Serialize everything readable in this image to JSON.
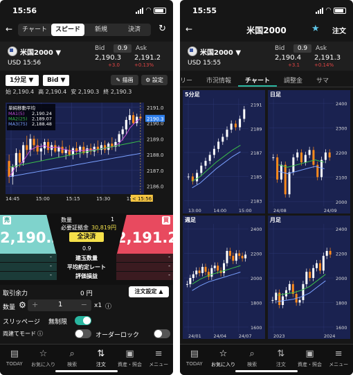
{
  "left": {
    "status": {
      "time": "15:56"
    },
    "tabs": [
      "チャート",
      "スピード",
      "新規",
      "決済"
    ],
    "instrument": {
      "name": "米国2000 ▼",
      "currency": "USD",
      "time": "15:56"
    },
    "quote": {
      "bid_label": "Bid",
      "ask_label": "Ask",
      "spread": "0.9",
      "bid": "2,190.3",
      "ask": "2,191.2",
      "change": "+3.0",
      "change_pct": "+0.13%"
    },
    "controls": {
      "timeframe": "1分足 ▼",
      "side": "Bid ▼",
      "draw": "描画",
      "settings": "設定"
    },
    "ohlc": {
      "o_label": "始",
      "o": "2,190.4",
      "h_label": "高",
      "h": "2,190.4",
      "l_label": "安",
      "l": "2,190.3",
      "c_label": "終",
      "c": "2,190.3"
    },
    "chart_data": {
      "type": "candlestick",
      "legend_title": "単純移動平均",
      "legend": [
        {
          "name": "MA1(5)",
          "value": "2,190.24",
          "color": "#c04bd6"
        },
        {
          "name": "MA2(25)",
          "value": "2,189.07",
          "color": "#3bbf4a"
        },
        {
          "name": "MA3(75)",
          "value": "2,188.48",
          "color": "#7aa0ff"
        }
      ],
      "y_ticks": [
        "2191.0",
        "2190.0",
        "2189.0",
        "2188.0",
        "2187.0",
        "2186.0"
      ],
      "ylim": [
        2185.5,
        2191.3
      ],
      "x_ticks": [
        "14:45",
        "15:00",
        "15:15",
        "15:30",
        "15:45"
      ],
      "last_price": "2190.3",
      "cursor_time": "< 15:56 >",
      "candles": [
        {
          "o": 2187.6,
          "h": 2188.0,
          "l": 2186.2,
          "c": 2186.6
        },
        {
          "o": 2186.6,
          "h": 2187.4,
          "l": 2186.1,
          "c": 2187.2
        },
        {
          "o": 2187.2,
          "h": 2188.4,
          "l": 2186.9,
          "c": 2188.1
        },
        {
          "o": 2188.1,
          "h": 2188.3,
          "l": 2187.2,
          "c": 2187.5
        },
        {
          "o": 2187.5,
          "h": 2188.8,
          "l": 2187.3,
          "c": 2188.6
        },
        {
          "o": 2188.6,
          "h": 2189.2,
          "l": 2188.0,
          "c": 2188.3
        },
        {
          "o": 2188.3,
          "h": 2189.3,
          "l": 2187.9,
          "c": 2189.0
        },
        {
          "o": 2189.0,
          "h": 2189.2,
          "l": 2188.2,
          "c": 2188.6
        },
        {
          "o": 2188.6,
          "h": 2189.0,
          "l": 2188.0,
          "c": 2188.2
        },
        {
          "o": 2188.2,
          "h": 2188.7,
          "l": 2187.6,
          "c": 2188.4
        },
        {
          "o": 2188.4,
          "h": 2189.0,
          "l": 2188.0,
          "c": 2188.8
        },
        {
          "o": 2188.8,
          "h": 2189.0,
          "l": 2188.1,
          "c": 2188.3
        },
        {
          "o": 2188.3,
          "h": 2188.8,
          "l": 2187.9,
          "c": 2188.6
        },
        {
          "o": 2188.6,
          "h": 2188.9,
          "l": 2188.1,
          "c": 2188.2
        },
        {
          "o": 2188.2,
          "h": 2188.6,
          "l": 2187.8,
          "c": 2188.5
        },
        {
          "o": 2188.5,
          "h": 2188.9,
          "l": 2188.0,
          "c": 2188.1
        },
        {
          "o": 2188.1,
          "h": 2188.5,
          "l": 2187.7,
          "c": 2188.3
        },
        {
          "o": 2188.3,
          "h": 2188.6,
          "l": 2187.9,
          "c": 2188.0
        },
        {
          "o": 2188.0,
          "h": 2188.5,
          "l": 2187.7,
          "c": 2188.4
        },
        {
          "o": 2188.4,
          "h": 2188.8,
          "l": 2188.0,
          "c": 2188.2
        },
        {
          "o": 2188.2,
          "h": 2188.6,
          "l": 2187.8,
          "c": 2188.5
        },
        {
          "o": 2188.5,
          "h": 2188.8,
          "l": 2188.0,
          "c": 2188.1
        },
        {
          "o": 2188.1,
          "h": 2188.6,
          "l": 2187.8,
          "c": 2188.4
        },
        {
          "o": 2188.4,
          "h": 2188.7,
          "l": 2188.0,
          "c": 2188.2
        },
        {
          "o": 2188.2,
          "h": 2188.7,
          "l": 2187.9,
          "c": 2188.5
        },
        {
          "o": 2188.5,
          "h": 2188.9,
          "l": 2188.1,
          "c": 2188.3
        },
        {
          "o": 2188.3,
          "h": 2188.8,
          "l": 2188.0,
          "c": 2188.6
        },
        {
          "o": 2188.6,
          "h": 2188.9,
          "l": 2188.1,
          "c": 2188.3
        },
        {
          "o": 2188.3,
          "h": 2188.8,
          "l": 2188.0,
          "c": 2188.7
        },
        {
          "o": 2188.7,
          "h": 2189.1,
          "l": 2188.3,
          "c": 2188.5
        },
        {
          "o": 2188.5,
          "h": 2189.0,
          "l": 2188.2,
          "c": 2188.8
        },
        {
          "o": 2188.8,
          "h": 2189.5,
          "l": 2188.5,
          "c": 2189.3
        },
        {
          "o": 2189.3,
          "h": 2189.8,
          "l": 2188.9,
          "c": 2189.6
        },
        {
          "o": 2189.6,
          "h": 2190.4,
          "l": 2189.3,
          "c": 2190.2
        },
        {
          "o": 2190.2,
          "h": 2190.9,
          "l": 2189.9,
          "c": 2190.5
        },
        {
          "o": 2190.5,
          "h": 2190.7,
          "l": 2189.9,
          "c": 2190.0
        },
        {
          "o": 2190.0,
          "h": 2190.6,
          "l": 2189.8,
          "c": 2190.4
        },
        {
          "o": 2190.4,
          "h": 2190.6,
          "l": 2190.1,
          "c": 2190.3
        }
      ]
    },
    "trade": {
      "sell_label": "売",
      "buy_label": "買",
      "sell_price": "2,190.3",
      "buy_price": "2,191.2",
      "qty_label": "数量",
      "qty_value": "1",
      "margin_label": "必要証拠金",
      "margin_value": "30,819円",
      "close_all": "全決済",
      "spread": "0.9",
      "pos_rows": [
        {
          "label": "建玉数量",
          "left": "-",
          "right": "-"
        },
        {
          "label": "平均約定レート",
          "left": "-",
          "right": "-"
        },
        {
          "label": "評価損益",
          "left": "-",
          "right": "-"
        }
      ]
    },
    "order": {
      "available_label": "取引余力",
      "available_value": "0 円",
      "settings_btn": "注文設定 ▲",
      "qty_label": "数量",
      "qty_value": "1",
      "multiplier": "x1",
      "slippage_label": "スリッページ",
      "slippage_value": "無制限",
      "both_label": "両建てモード",
      "autolock_label": "オーダーロック"
    },
    "tabbar": [
      "TODAY",
      "お気に入り",
      "検索",
      "注文",
      "資産・照会",
      "メニュー"
    ]
  },
  "right": {
    "status": {
      "time": "15:55"
    },
    "title": "米国2000",
    "order_btn": "注文",
    "instrument": {
      "name": "米国2000 ▼",
      "currency": "USD",
      "time": "15:55"
    },
    "quote": {
      "bid_label": "Bid",
      "ask_label": "Ask",
      "spread": "0.9",
      "bid": "2,190.4",
      "ask": "2,191.3",
      "change": "+3.1",
      "change_pct": "+0.14%"
    },
    "subtabs": [
      "リー",
      "市況情報",
      "チャート",
      "調整金",
      "サマ"
    ],
    "mini_charts": [
      {
        "label": "5分足",
        "y_ticks": [
          "2191",
          "2189",
          "2187",
          "2185",
          "2183"
        ],
        "x_ticks": [
          "13:00",
          "14:00",
          "15:00"
        ],
        "ylim": [
          2182.5,
          2191.5
        ],
        "trend": [
          2185.0,
          2184.6,
          2185.3,
          2185.9,
          2186.3,
          2186.8,
          2187.3,
          2187.9,
          2188.3,
          2188.9,
          2189.4,
          2189.1,
          2189.8,
          2190.6
        ],
        "ma": [
          2184.6,
          2185.0,
          2185.6,
          2186.2,
          2186.7,
          2187.2,
          2187.6
        ]
      },
      {
        "label": "日足",
        "y_ticks": [
          "2400",
          "2300",
          "2200",
          "2100",
          "2000"
        ],
        "x_ticks": [
          "24/08",
          "24/09"
        ],
        "ylim": [
          1980,
          2420
        ],
        "trend": [
          2180,
          2090,
          2150,
          2030,
          2120,
          2180,
          2200,
          2160,
          2190,
          2210,
          2150,
          2100,
          2170,
          2200,
          2180
        ],
        "ma": [
          2150,
          2140,
          2150,
          2160,
          2170,
          2160
        ]
      },
      {
        "label": "週足",
        "y_ticks": [
          "2400",
          "2200",
          "2000",
          "1800",
          "1600"
        ],
        "x_ticks": [
          "24/01",
          "24/04",
          "24/07"
        ],
        "ylim": [
          1560,
          2440
        ],
        "trend": [
          1950,
          2000,
          2030,
          2060,
          2040,
          2090,
          2050,
          2010,
          2080,
          2100,
          2060,
          2040,
          2120,
          2220,
          2180,
          2140,
          2200,
          2180,
          2160,
          2190
        ],
        "ma": [
          1950,
          1990,
          2020,
          2040,
          2060,
          2080,
          2100
        ]
      },
      {
        "label": "月足",
        "y_ticks": [
          "2400",
          "2200",
          "2000",
          "1800",
          "1600"
        ],
        "x_ticks": [
          "2023",
          "2024"
        ],
        "ylim": [
          1560,
          2440
        ],
        "trend": [
          1820,
          1880,
          1780,
          1850,
          1900,
          1950,
          1870,
          1800,
          1820,
          1950,
          2050,
          2000,
          2080,
          2120,
          2060,
          2180,
          2220,
          2190
        ],
        "ma": [
          1860,
          1870,
          1880,
          1900,
          1930,
          1980,
          2030
        ]
      }
    ],
    "tabbar": [
      "TODAY",
      "お気に入り",
      "検索",
      "注文",
      "資産・照会",
      "メニュー"
    ]
  }
}
